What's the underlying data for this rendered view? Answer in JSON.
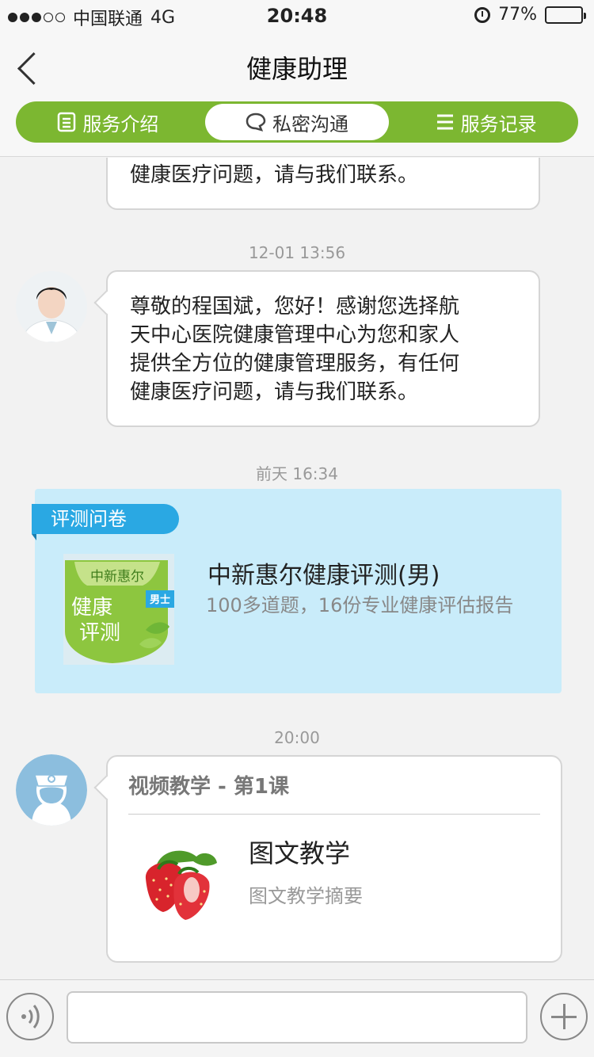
{
  "status_bar": {
    "carrier": "中国联通",
    "network": "4G",
    "time": "20:48",
    "battery": "77%",
    "battery_level": 0.77
  },
  "nav": {
    "title": "健康助理"
  },
  "tabs": [
    {
      "label": "服务介绍",
      "icon": "document-icon",
      "active": false
    },
    {
      "label": "私密沟通",
      "icon": "chat-bubble-icon",
      "active": true
    },
    {
      "label": "服务记录",
      "icon": "list-icon",
      "active": false
    }
  ],
  "messages": {
    "partial": {
      "text": "健康医疗问题，请与我们联系。"
    },
    "ts1": "12-01 13:56",
    "welcome": {
      "lines": [
        "尊敬的程国斌，您好！感谢您选择航",
        "天中心医院健康管理中心为您和家人",
        "提供全方位的健康管理服务，有任何",
        "健康医疗问题，请与我们联系。"
      ]
    },
    "ts2": "前天 16:34",
    "survey": {
      "ribbon": "评测问卷",
      "title": "中新惠尔健康评测(男)",
      "desc": "100多道题，16份专业健康评估报告",
      "thumb_brand": "中新惠尔",
      "thumb_line1": "健康",
      "thumb_line2": "评测",
      "thumb_tag": "男士"
    },
    "ts3": "20:00",
    "video": {
      "header": "视频教学 - 第1课",
      "item_title": "图文教学",
      "item_sub": "图文教学摘要"
    }
  },
  "input": {
    "value": "",
    "placeholder": ""
  },
  "colors": {
    "brand_green": "#7cb731",
    "survey_bg": "#c9ecfa",
    "ribbon_blue": "#2aa8e3"
  }
}
